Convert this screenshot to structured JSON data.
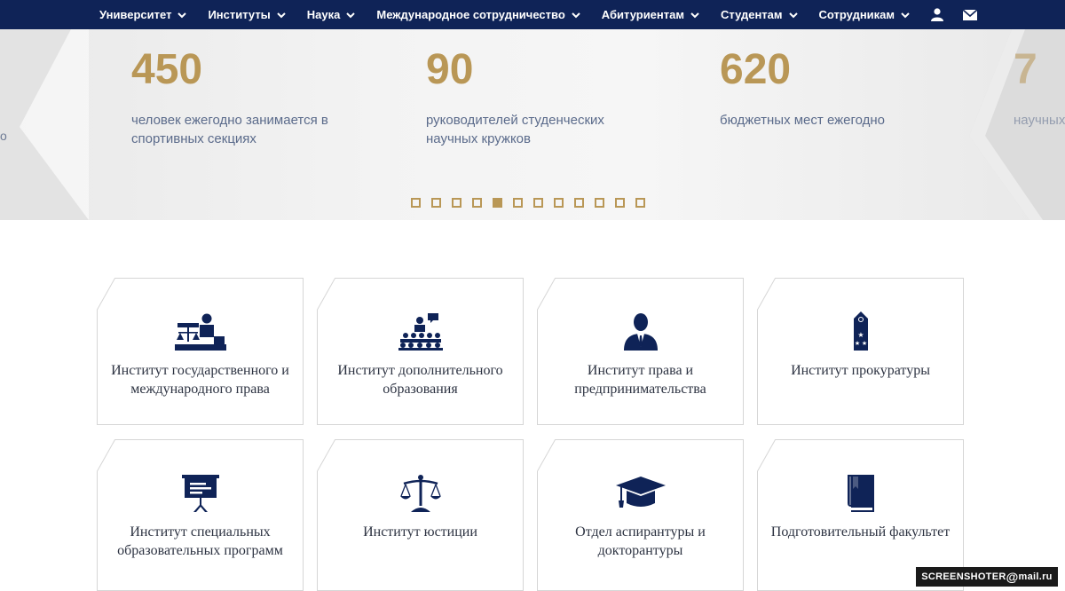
{
  "nav": {
    "items": [
      {
        "label": "Университет"
      },
      {
        "label": "Институты"
      },
      {
        "label": "Наука"
      },
      {
        "label": "Международное сотрудничество"
      },
      {
        "label": "Абитуриентам"
      },
      {
        "label": "Студентам"
      },
      {
        "label": "Сотрудникам"
      }
    ],
    "icons": [
      "user-icon",
      "mail-icon"
    ]
  },
  "stats": {
    "items": [
      {
        "value": "450",
        "label": "человек ежегодно занимается в спортивных секциях"
      },
      {
        "value": "90",
        "label": "руководителей студенческих научных кружков"
      },
      {
        "value": "620",
        "label": "бюджетных мест ежегодно"
      },
      {
        "value": "7",
        "label": "научных"
      }
    ],
    "left_fragment": "о",
    "dots_count": 12,
    "active_dot": 5
  },
  "cards": [
    {
      "title": "Институт государственного и международного права",
      "icon": "lawyer-desk-icon"
    },
    {
      "title": "Институт дополнительного образования",
      "icon": "lecture-audience-icon"
    },
    {
      "title": "Институт права и предпринимательства",
      "icon": "businessman-icon"
    },
    {
      "title": "Институт прокуратуры",
      "icon": "shoulder-strap-icon"
    },
    {
      "title": "Институт специальных образовательных программ",
      "icon": "presentation-board-icon"
    },
    {
      "title": "Институт юстиции",
      "icon": "scales-icon"
    },
    {
      "title": "Отдел аспирантуры и докторантуры",
      "icon": "graduation-cap-icon"
    },
    {
      "title": "Подготовительный факультет",
      "icon": "book-icon"
    }
  ],
  "watermark": {
    "left": "SCREENSHOTER",
    "at": "@",
    "right": "mail.ru"
  },
  "colors": {
    "nav_bg": "#0f2357",
    "accent": "#b99756",
    "icon": "#0f2357"
  }
}
